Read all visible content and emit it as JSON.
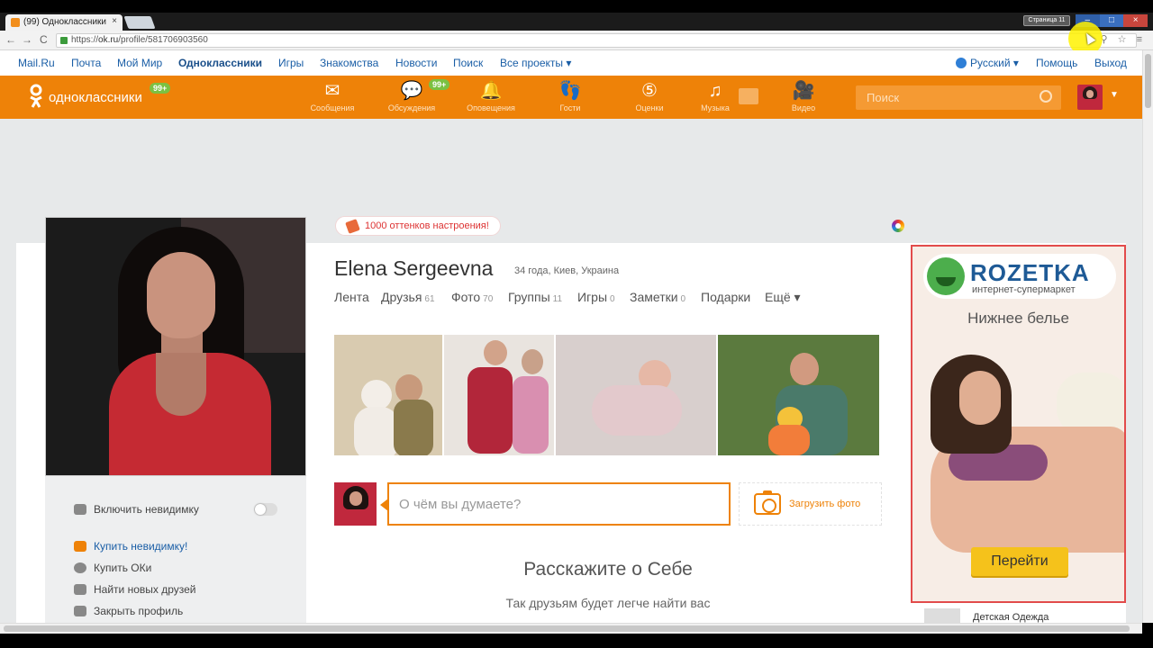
{
  "browser": {
    "tab_title": "(99) Одноклассники",
    "tab_close": "×",
    "window_label": "Страница 11",
    "url_scheme": "https://",
    "url_host": "ok.ru",
    "url_path": "/profile/581706903560",
    "back": "←",
    "forward": "→",
    "reload": "C",
    "window_buttons": {
      "minimize": "–",
      "maximize": "□",
      "close": "×"
    },
    "addr_icons": "⚲ ☆ ≡"
  },
  "topnav": {
    "links": [
      "Mail.Ru",
      "Почта",
      "Мой Мир",
      "Одноклассники",
      "Игры",
      "Знакомства",
      "Новости",
      "Поиск",
      "Все проекты ▾"
    ],
    "language": "Русский ▾",
    "help": "Помощь",
    "logout": "Выход"
  },
  "okheader": {
    "logo_text": "одноклассники",
    "logo_badge": "99+",
    "nav": [
      {
        "label": "Сообщения",
        "icon": "envelope-icon",
        "glyph": "✉"
      },
      {
        "label": "Обсуждения",
        "icon": "discussions-icon",
        "glyph": "💬",
        "badge": "99+"
      },
      {
        "label": "Оповещения",
        "icon": "bell-icon",
        "glyph": "🔔"
      },
      {
        "label": "Гости",
        "icon": "footprints-icon",
        "glyph": "👣"
      },
      {
        "label": "Оценки",
        "icon": "rating-icon",
        "glyph": "⑤"
      },
      {
        "label": "Музыка",
        "icon": "music-icon",
        "glyph": "♫"
      },
      {
        "label": "Видео",
        "icon": "video-icon",
        "glyph": "🎥"
      }
    ],
    "search_placeholder": "Поиск",
    "caret": "▼"
  },
  "profile": {
    "mood": "1000 оттенков настроения!",
    "name": "Elena Sergeevna",
    "meta": "34 года, Киев, Украина",
    "tabs": [
      {
        "label": "Лента",
        "count": ""
      },
      {
        "label": "Друзья",
        "count": "61"
      },
      {
        "label": "Фото",
        "count": "70"
      },
      {
        "label": "Группы",
        "count": "11"
      },
      {
        "label": "Игры",
        "count": "0"
      },
      {
        "label": "Заметки",
        "count": "0"
      },
      {
        "label": "Подарки",
        "count": ""
      },
      {
        "label": "Ещё ▾",
        "count": ""
      }
    ],
    "post_placeholder": "О чём вы думаете?",
    "upload_photo": "Загрузить фото",
    "about_title": "Расскажите о Себе",
    "about_sub": "Так друзьям будет легче найти вас"
  },
  "left_menu": {
    "invisible_toggle": "Включить невидимку",
    "invisible_on": false,
    "items": [
      "Купить невидимку!",
      "Купить ОКи",
      "Найти новых друзей",
      "Закрыть профиль"
    ]
  },
  "ad": {
    "brand": "ROZETKA",
    "tagline": "интернет-супермаркет",
    "category": "Нижнее белье",
    "button": "Перейти",
    "next_item": "Детская Одежда"
  },
  "colors": {
    "ok_orange": "#ee8208",
    "link_blue": "#1a5ea6",
    "badge_green": "#7bc142",
    "ad_border": "#e24b4b"
  }
}
